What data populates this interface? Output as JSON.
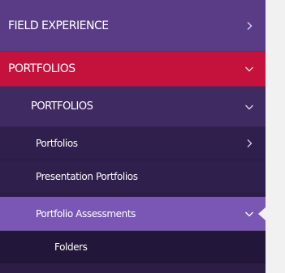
{
  "sidebar": {
    "field_experience": {
      "label": "FIELD EXPERIENCE",
      "icon": "chevron-right-icon"
    },
    "portfolios_section": {
      "label": "PORTFOLIOS",
      "icon": "chevron-down-icon"
    },
    "portfolios_subsection": {
      "label": "PORTFOLIOS",
      "icon": "chevron-down-icon"
    },
    "items": [
      {
        "label": "Portfolios",
        "icon": "chevron-right-icon"
      },
      {
        "label": "Presentation Portfolios"
      },
      {
        "label": "Portfolio Assessments",
        "icon": "chevron-down-icon",
        "active": true
      },
      {
        "label": "Folders"
      }
    ]
  },
  "colors": {
    "field_experience_bg": "#5a3c86",
    "portfolios_bg": "#c5123d",
    "subsection_bg": "#3f2b62",
    "item_bg": "#2e1f4c",
    "active_item_bg": "#7a57b5",
    "folders_bg": "#22163a",
    "page_bg": "#f1f1f1"
  }
}
